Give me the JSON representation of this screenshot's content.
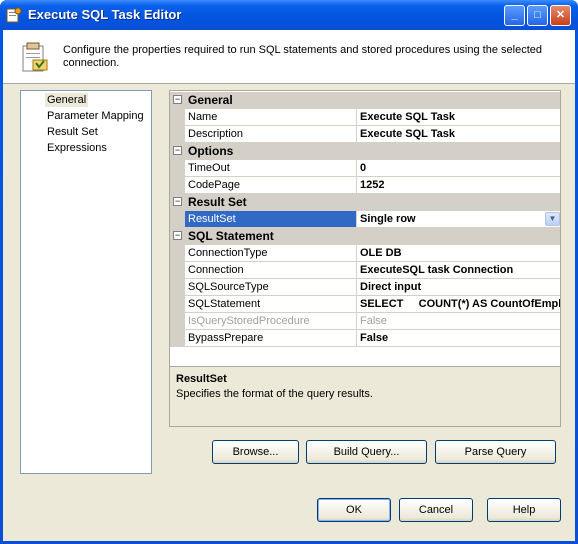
{
  "window": {
    "title": "Execute SQL Task Editor"
  },
  "header": {
    "text": "Configure the properties required to run SQL statements and stored procedures using the selected connection."
  },
  "nav": {
    "items": [
      {
        "label": "General",
        "selected": true
      },
      {
        "label": "Parameter Mapping"
      },
      {
        "label": "Result Set"
      },
      {
        "label": "Expressions"
      }
    ]
  },
  "grid": {
    "general": {
      "category": "General",
      "name_label": "Name",
      "name_value": "Execute SQL Task",
      "desc_label": "Description",
      "desc_value": "Execute SQL Task"
    },
    "options": {
      "category": "Options",
      "timeout_label": "TimeOut",
      "timeout_value": "0",
      "codepage_label": "CodePage",
      "codepage_value": "1252"
    },
    "resultset": {
      "category": "Result Set",
      "resultset_label": "ResultSet",
      "resultset_value": "Single row"
    },
    "sql": {
      "category": "SQL Statement",
      "conntype_label": "ConnectionType",
      "conntype_value": "OLE DB",
      "conn_label": "Connection",
      "conn_value": "ExecuteSQL task Connection",
      "srctype_label": "SQLSourceType",
      "srctype_value": "Direct input",
      "stmt_label": "SQLStatement",
      "stmt_value": "SELECT     COUNT(*) AS CountOfEmpl",
      "isstored_label": "IsQueryStoredProcedure",
      "isstored_value": "False",
      "bypass_label": "BypassPrepare",
      "bypass_value": "False"
    }
  },
  "description": {
    "title": "ResultSet",
    "text": "Specifies the format of the query results."
  },
  "buttons": {
    "browse": "Browse...",
    "build_query": "Build Query...",
    "parse_query": "Parse Query",
    "ok": "OK",
    "cancel": "Cancel",
    "help": "Help"
  },
  "colors": {
    "titlebar": "#0a5fe8",
    "selection": "#316ac5",
    "dialog_bg": "#ece9d8"
  }
}
